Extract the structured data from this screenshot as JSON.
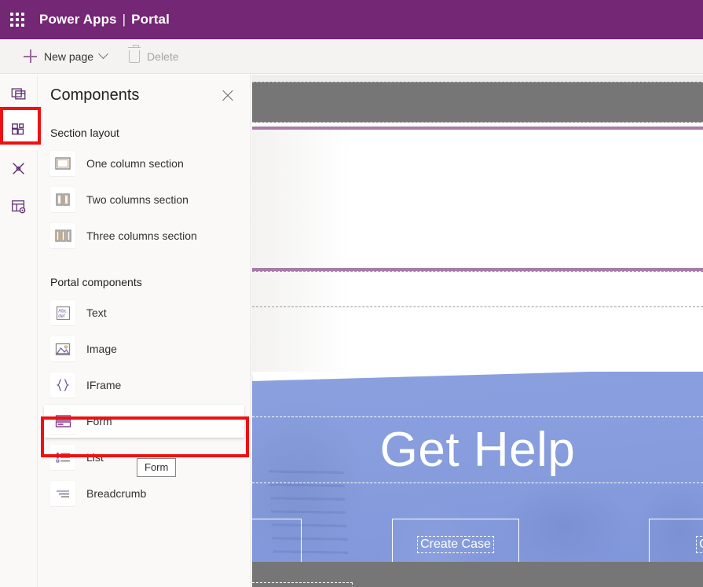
{
  "topbar": {
    "waffle_icon": "waffle-grid-icon",
    "app_name": "Power Apps",
    "separator": "|",
    "context_name": "Portal"
  },
  "commandbar": {
    "new_page_label": "New page",
    "new_page_icon": "plus-icon",
    "new_page_chevron_icon": "chevron-down-icon",
    "delete_label": "Delete",
    "delete_icon": "trash-icon",
    "delete_disabled": true
  },
  "rail": {
    "items": [
      {
        "name": "pages",
        "icon": "pages-icon",
        "active": false
      },
      {
        "name": "components",
        "icon": "components-grid-icon",
        "active": true
      },
      {
        "name": "styling",
        "icon": "theme-brush-icon",
        "active": false
      },
      {
        "name": "data",
        "icon": "table-settings-icon",
        "active": false
      }
    ]
  },
  "panel": {
    "title": "Components",
    "close_icon": "close-icon",
    "groups": [
      {
        "title": "Section layout",
        "items": [
          {
            "label": "One column section",
            "icon": "one-column-icon"
          },
          {
            "label": "Two columns section",
            "icon": "two-columns-icon"
          },
          {
            "label": "Three columns section",
            "icon": "three-columns-icon"
          }
        ]
      },
      {
        "title": "Portal components",
        "items": [
          {
            "label": "Text",
            "icon": "text-abc-icon",
            "hover": false
          },
          {
            "label": "Image",
            "icon": "image-icon",
            "hover": false
          },
          {
            "label": "IFrame",
            "icon": "iframe-braces-icon",
            "hover": false
          },
          {
            "label": "Form",
            "icon": "form-icon",
            "hover": true
          },
          {
            "label": "List",
            "icon": "list-icon",
            "hover": false
          },
          {
            "label": "Breadcrumb",
            "icon": "breadcrumb-icon",
            "hover": false
          }
        ]
      }
    ],
    "tooltip": "Form"
  },
  "canvas": {
    "hero_title": "Get Help",
    "buttons": [
      {
        "label": ""
      },
      {
        "label": "Create Case"
      },
      {
        "label": "Cont"
      }
    ]
  },
  "colors": {
    "brand_purple": "#742774",
    "annotation_red": "#ee1111",
    "hero_blue": "#879ddd",
    "canvas_gray": "#767676",
    "rule_purple": "#a87ba8"
  }
}
